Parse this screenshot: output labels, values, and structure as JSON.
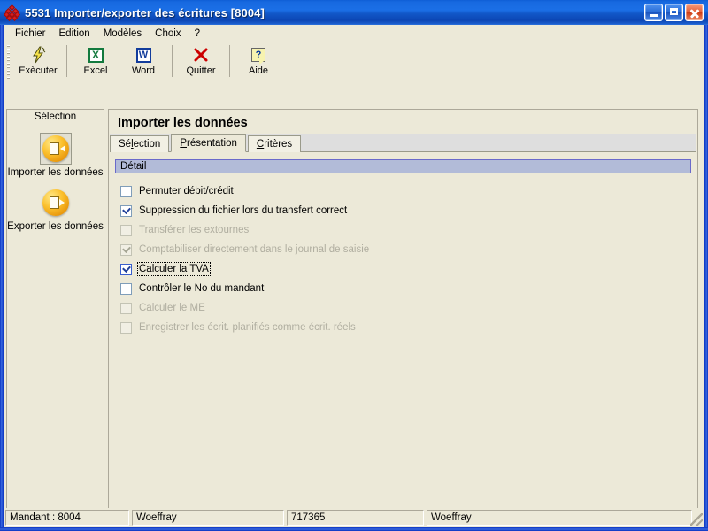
{
  "window": {
    "title": "5531 Importer/exporter des écritures [8004]",
    "icon": "app-diamond-icon",
    "buttons": {
      "minimize": "Minimiser",
      "maximize": "Agrandir",
      "close": "Fermer"
    },
    "accent_title_start": "#1b6fe6",
    "accent_title_end": "#0c46b4",
    "face_color": "#ece9d8"
  },
  "menubar": {
    "items": [
      {
        "label": "Fichier"
      },
      {
        "label": "Edition"
      },
      {
        "label": "Modèles"
      },
      {
        "label": "Choix"
      },
      {
        "label": "?"
      }
    ]
  },
  "toolbar": {
    "items": [
      {
        "label": "Exècuter",
        "icon": "lightning-icon"
      },
      {
        "label": "Excel",
        "icon": "excel-icon",
        "glyph": "X"
      },
      {
        "label": "Word",
        "icon": "word-icon",
        "glyph": "W"
      },
      {
        "label": "Quitter",
        "icon": "red-x-icon"
      },
      {
        "label": "Aide",
        "icon": "help-balloon-icon",
        "glyph": "?"
      }
    ]
  },
  "sidebar": {
    "header": "Sélection",
    "items": [
      {
        "label": "Importer les données",
        "icon": "import-data-orb-icon",
        "selected": true
      },
      {
        "label": "Exporter les données",
        "icon": "export-data-orb-icon",
        "selected": false
      }
    ]
  },
  "main": {
    "page_title": "Importer les données",
    "tabs": [
      {
        "label": "Sélection",
        "accel_index": 2,
        "active": false
      },
      {
        "label": "Présentation",
        "accel_index": 0,
        "active": true
      },
      {
        "label": "Critères",
        "accel_index": 0,
        "active": false
      }
    ],
    "group_header": "Détail",
    "group_header_bg": "#b2bbd8",
    "checkboxes": [
      {
        "label": "Permuter débit/crédit",
        "checked": false,
        "disabled": false,
        "focused": false
      },
      {
        "label": "Suppression du fichier lors du transfert correct",
        "checked": true,
        "disabled": false,
        "focused": false
      },
      {
        "label": "Transférer les extournes",
        "checked": false,
        "disabled": true,
        "focused": false
      },
      {
        "label": "Comptabiliser directement dans le journal de saisie",
        "checked": true,
        "disabled": true,
        "focused": false
      },
      {
        "label": "Calculer la TVA",
        "checked": true,
        "disabled": false,
        "focused": true
      },
      {
        "label": "Contrôler le No du mandant",
        "checked": false,
        "disabled": false,
        "focused": false
      },
      {
        "label": "Calculer le ME",
        "checked": false,
        "disabled": true,
        "focused": false
      },
      {
        "label": "Enregistrer les écrit. planifiés comme écrit. réels",
        "checked": false,
        "disabled": true,
        "focused": false
      }
    ]
  },
  "statusbar": {
    "panes": [
      {
        "text": "Mandant : 8004"
      },
      {
        "text": "Woeffray"
      },
      {
        "text": "717365"
      },
      {
        "text": "Woeffray"
      }
    ],
    "resize_grip": "resize-grip-icon"
  }
}
